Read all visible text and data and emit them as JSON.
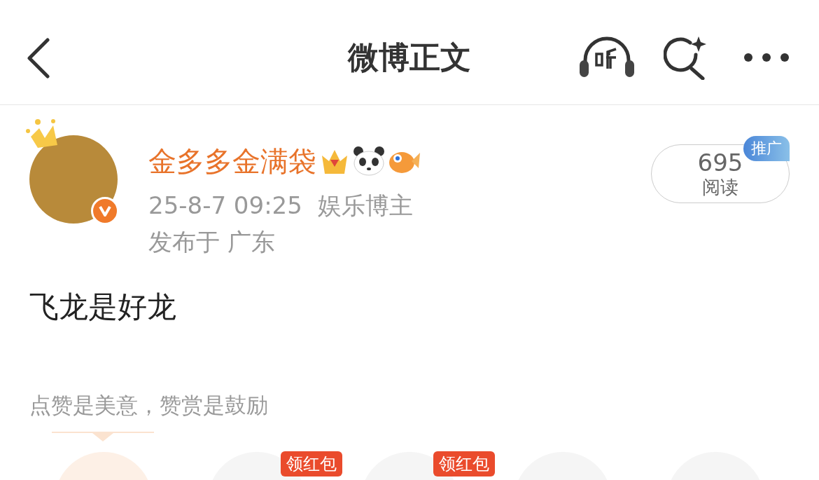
{
  "header": {
    "title": "微博正文"
  },
  "post": {
    "author": "金多多金满袋",
    "verified": true,
    "time": "25-8-7 09:25",
    "author_tag": "娱乐博主",
    "location": "发布于 广东",
    "read_count": "695",
    "read_label": "阅读",
    "promo_badge": "推广",
    "text": "飞龙是好龙"
  },
  "reward": {
    "tip": "点赞是美意，赞赏是鼓励",
    "items": [
      {
        "selected": true
      },
      {
        "selected": false,
        "badge": "领红包"
      },
      {
        "selected": false,
        "badge": "领红包"
      },
      {
        "selected": false
      },
      {
        "selected": false
      }
    ]
  }
}
